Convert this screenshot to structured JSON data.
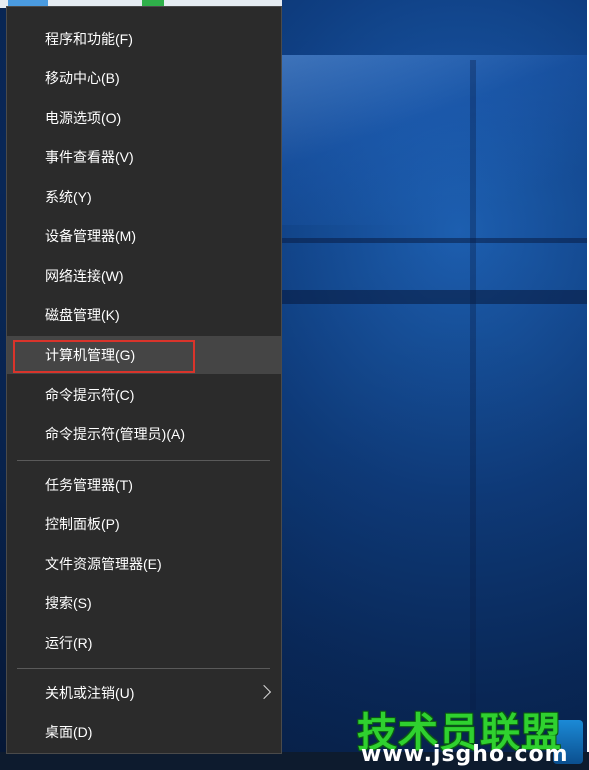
{
  "context_menu": {
    "items_group1": [
      {
        "label": "程序和功能(F)",
        "name": "menu-item-programs-features"
      },
      {
        "label": "移动中心(B)",
        "name": "menu-item-mobility-center"
      },
      {
        "label": "电源选项(O)",
        "name": "menu-item-power-options"
      },
      {
        "label": "事件查看器(V)",
        "name": "menu-item-event-viewer"
      },
      {
        "label": "系统(Y)",
        "name": "menu-item-system"
      },
      {
        "label": "设备管理器(M)",
        "name": "menu-item-device-manager"
      },
      {
        "label": "网络连接(W)",
        "name": "menu-item-network-connections"
      },
      {
        "label": "磁盘管理(K)",
        "name": "menu-item-disk-management"
      },
      {
        "label": "计算机管理(G)",
        "name": "menu-item-computer-management"
      },
      {
        "label": "命令提示符(C)",
        "name": "menu-item-command-prompt"
      },
      {
        "label": "命令提示符(管理员)(A)",
        "name": "menu-item-command-prompt-admin"
      }
    ],
    "items_group2": [
      {
        "label": "任务管理器(T)",
        "name": "menu-item-task-manager"
      },
      {
        "label": "控制面板(P)",
        "name": "menu-item-control-panel"
      },
      {
        "label": "文件资源管理器(E)",
        "name": "menu-item-file-explorer"
      },
      {
        "label": "搜索(S)",
        "name": "menu-item-search"
      },
      {
        "label": "运行(R)",
        "name": "menu-item-run"
      }
    ],
    "items_group3": [
      {
        "label": "关机或注销(U)",
        "name": "menu-item-shutdown-signout",
        "submenu_icon": "chevron-right-icon"
      },
      {
        "label": "桌面(D)",
        "name": "menu-item-desktop"
      }
    ],
    "hovered_item": "计算机管理(G)",
    "highlight_color": "#d9342b"
  },
  "watermark": {
    "title": "技术员联盟",
    "url": "www.jsgho.com"
  }
}
